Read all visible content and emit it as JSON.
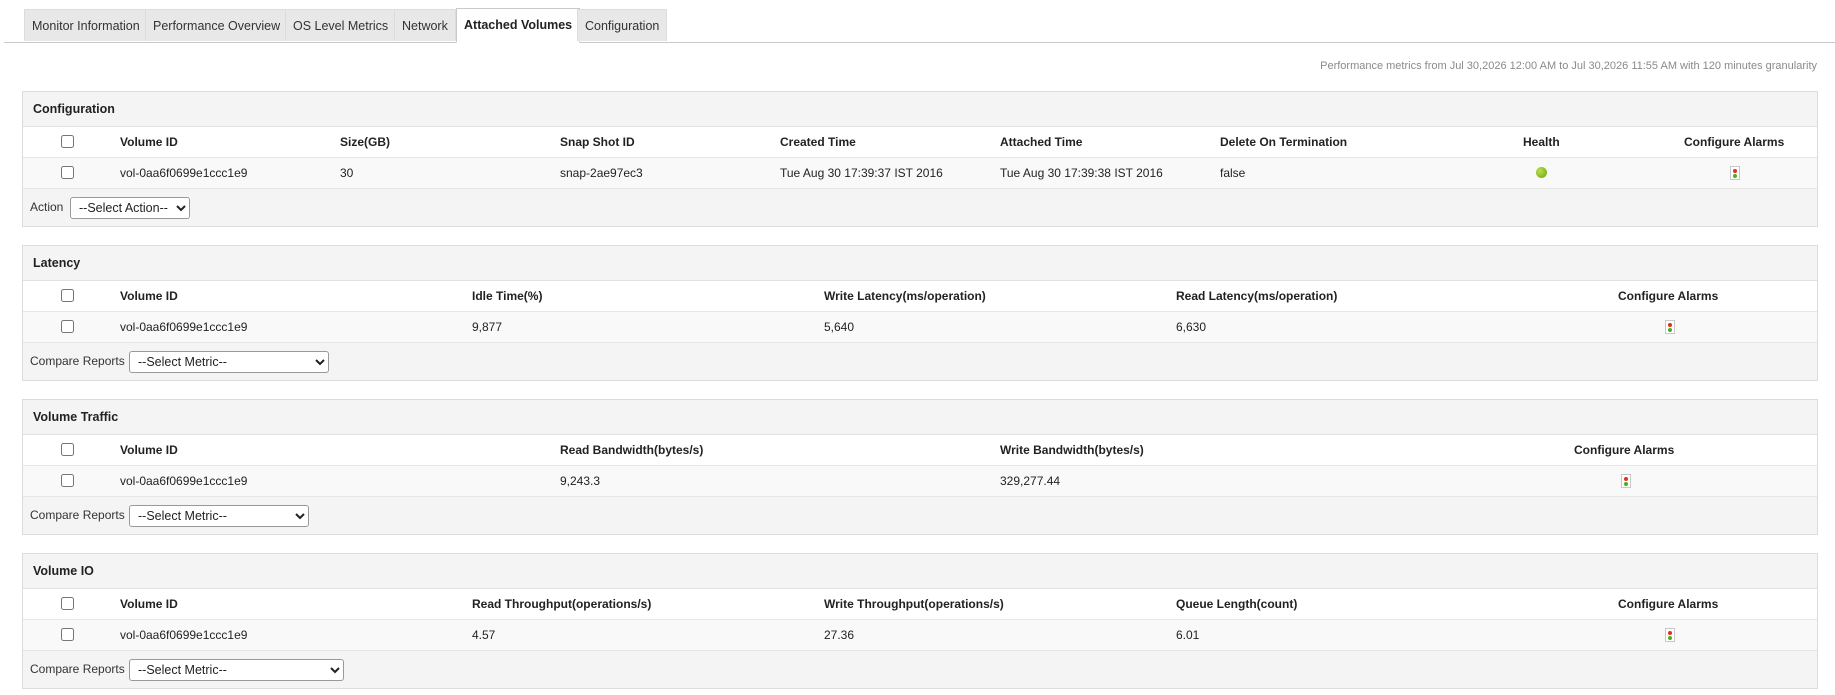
{
  "tabs": [
    {
      "label": "Monitor Information"
    },
    {
      "label": "Performance Overview"
    },
    {
      "label": "OS Level Metrics"
    },
    {
      "label": "Network"
    },
    {
      "label": "Attached Volumes",
      "active": true
    },
    {
      "label": "Configuration"
    }
  ],
  "period_text": "Performance metrics from Jul 30,2026 12:00 AM to Jul 30,2026 11:55 AM with 120 minutes granularity",
  "configuration": {
    "title": "Configuration",
    "headers": [
      "Volume ID",
      "Size(GB)",
      "Snap Shot ID",
      "Created Time",
      "Attached Time",
      "Delete On Termination",
      "Health",
      "Configure Alarms"
    ],
    "row": {
      "volume_id": "vol-0aa6f0699e1ccc1e9",
      "size": "30",
      "snapshot_id": "snap-2ae97ec3",
      "created_time": "Tue Aug 30 17:39:37 IST 2016",
      "attached_time": "Tue Aug 30 17:39:38 IST 2016",
      "delete_on_termination": "false",
      "health": "green-status-dot",
      "alarm_icon": "traffic-light-icon"
    },
    "action_label": "Action",
    "action_select": "--Select Action--"
  },
  "latency": {
    "title": "Latency",
    "headers": [
      "Volume ID",
      "Idle Time(%)",
      "Write Latency(ms/operation)",
      "Read Latency(ms/operation)",
      "Configure Alarms"
    ],
    "row": [
      "vol-0aa6f0699e1ccc1e9",
      "9,877",
      "5,640",
      "6,630"
    ],
    "compare_label": "Compare Reports",
    "metric_select": "--Select Metric--"
  },
  "traffic": {
    "title": "Volume Traffic",
    "headers": [
      "Volume ID",
      "Read Bandwidth(bytes/s)",
      "Write Bandwidth(bytes/s)",
      "Configure Alarms"
    ],
    "row": [
      "vol-0aa6f0699e1ccc1e9",
      "9,243.3",
      "329,277.44"
    ],
    "compare_label": "Compare Reports",
    "metric_select": "--Select Metric--"
  },
  "io": {
    "title": "Volume IO",
    "headers": [
      "Volume ID",
      "Read Throughput(operations/s)",
      "Write Throughput(operations/s)",
      "Queue Length(count)",
      "Configure Alarms"
    ],
    "row": [
      "vol-0aa6f0699e1ccc1e9",
      "4.57",
      "27.36",
      "6.01"
    ],
    "compare_label": "Compare Reports",
    "metric_select": "--Select Metric--"
  },
  "colors": {
    "health_ok": "#7bbf1a",
    "alarm_red": "#e0301e",
    "alarm_green": "#4caf20"
  }
}
